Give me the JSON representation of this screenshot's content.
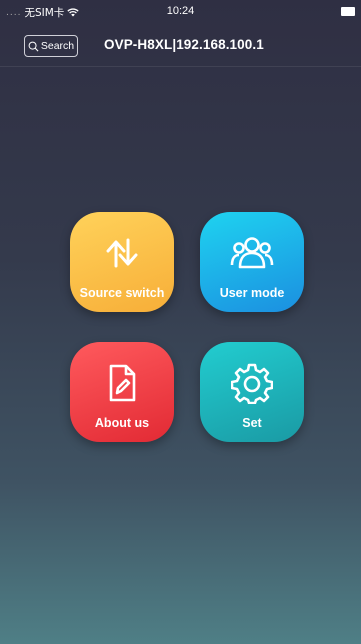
{
  "status_bar": {
    "carrier": "无SIM卡",
    "time": "10:24"
  },
  "nav": {
    "search_label": "Search",
    "title": "OVP-H8XL|192.168.100.1"
  },
  "tiles": [
    {
      "label": "Source switch",
      "icon": "arrows-swap-icon",
      "color": "#f9b83c"
    },
    {
      "label": "User mode",
      "icon": "users-group-icon",
      "color": "#1ea8e8"
    },
    {
      "label": "About us",
      "icon": "document-edit-icon",
      "color": "#ef3b42"
    },
    {
      "label": "Set",
      "icon": "gear-icon",
      "color": "#1fb3ba"
    }
  ]
}
